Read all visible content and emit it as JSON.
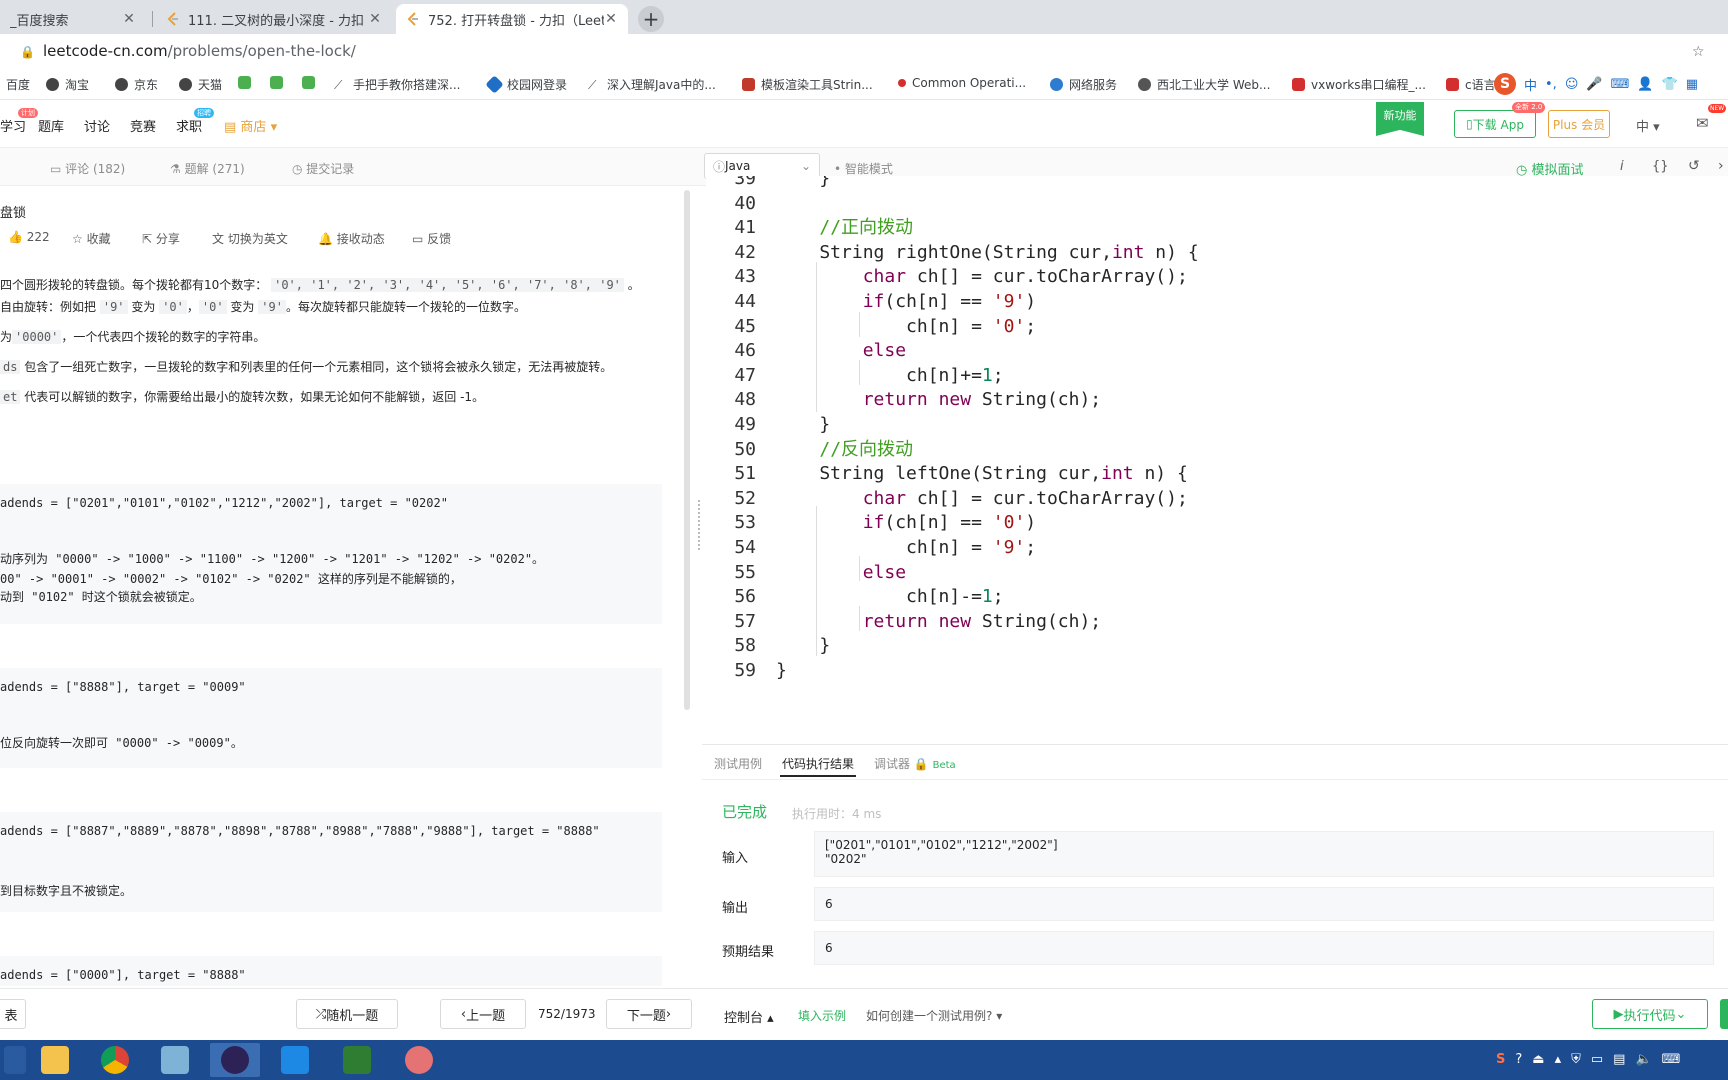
{
  "browser": {
    "tabs": [
      {
        "title": "_百度搜索",
        "active": false
      },
      {
        "title": "111. 二叉树的最小深度 - 力扣（L",
        "active": false
      },
      {
        "title": "752. 打开转盘锁 - 力扣（LeetCo",
        "active": true
      }
    ],
    "url_host": "leetcode-cn.com",
    "url_path": "/problems/open-the-lock/"
  },
  "bookmarks": [
    "百度",
    "淘宝",
    "京东",
    "天猫",
    "手把手教你搭建深...",
    "校园网登录",
    "深入理解Java中的...",
    "模板渲染工具Strin...",
    "Common Operati...",
    "网络服务",
    "西北工业大学 Web...",
    "vxworks串口编程_...",
    "c语言"
  ],
  "sitenav": {
    "items": [
      "学习",
      "题库",
      "讨论",
      "竞赛",
      "求职",
      "商店"
    ],
    "badge_plan": "计划",
    "badge_recruit": "招聘",
    "new_feature": "新功能",
    "download_app": "下载 App",
    "download_badge": "全新 2.0",
    "plus": "Plus 会员",
    "lang": "中",
    "notify_badge": "NEW"
  },
  "lefttools": {
    "comments": "评论 (182)",
    "solutions": "题解 (271)",
    "submissions": "提交记录"
  },
  "problem": {
    "title": "盘锁",
    "likes": "222",
    "favorite": "收藏",
    "share": "分享",
    "switch_lang": "切换为英文",
    "follow": "接收动态",
    "feedback": "反馈",
    "desc1": "四个圆形拨轮的转盘锁。每个拨轮都有10个数字：",
    "digits": "'0', '1', '2', '3', '4', '5', '6', '7', '8', '9'",
    "desc2a": "自由旋转：例如把",
    "desc2_c9": "'9'",
    "desc2b": "变为",
    "desc2_c0": "'0'",
    "desc2c": "，",
    "desc2_c0b": "'0'",
    "desc2d": "变为",
    "desc2_c9b": "'9'",
    "desc2e": "。每次旋转都只能旋转一个拨轮的一位数字。",
    "desc3a": "为",
    "desc3_code": "'0000'",
    "desc3b": "，一个代表四个拨轮的数字的字符串。",
    "desc4_code": "ds",
    "desc4": "包含了一组死亡数字，一旦拨轮的数字和列表里的任何一个元素相同，这个锁将会被永久锁定，无法再被旋转。",
    "desc5_code": "et",
    "desc5": "代表可以解锁的数字，你需要给出最小的旋转次数，如果无论如何不能解锁，返回 -1。",
    "ex1_input": "adends = [\"0201\",\"0101\",\"0102\",\"1212\",\"2002\"], target = \"0202\"",
    "ex1_l1": "动序列为 \"0000\" -> \"1000\" -> \"1100\" -> \"1200\" -> \"1201\" -> \"1202\" -> \"0202\"。",
    "ex1_l2": "00\" -> \"0001\" -> \"0002\" -> \"0102\" -> \"0202\" 这样的序列是不能解锁的，",
    "ex1_l3": "动到 \"0102\" 时这个锁就会被锁定。",
    "ex2_input": "adends = [\"8888\"], target = \"0009\"",
    "ex2_l1": "位反向旋转一次即可 \"0000\" -> \"0009\"。",
    "ex3_input": "adends = [\"8887\",\"8889\",\"8878\",\"8898\",\"8788\",\"8988\",\"7888\",\"9888\"], target = \"8888\"",
    "ex3_l1": "到目标数字且不被锁定。",
    "ex4_input": "adends = [\"0000\"], target = \"8888\""
  },
  "editorbar": {
    "language": "Java",
    "smart_mode": "智能模式",
    "mock_interview": "模拟面试"
  },
  "code": [
    {
      "n": "39",
      "text": "    }"
    },
    {
      "n": "40",
      "text": ""
    },
    {
      "n": "41",
      "text": "    //正向拨动"
    },
    {
      "n": "42",
      "text": "    String rightOne(String cur,int n) {"
    },
    {
      "n": "43",
      "text": "        char ch[] = cur.toCharArray();"
    },
    {
      "n": "44",
      "text": "        if(ch[n] == '9')"
    },
    {
      "n": "45",
      "text": "            ch[n] = '0';"
    },
    {
      "n": "46",
      "text": "        else"
    },
    {
      "n": "47",
      "text": "            ch[n]+=1;"
    },
    {
      "n": "48",
      "text": "        return new String(ch);"
    },
    {
      "n": "49",
      "text": "    }"
    },
    {
      "n": "50",
      "text": "    //反向拨动"
    },
    {
      "n": "51",
      "text": "    String leftOne(String cur,int n) {"
    },
    {
      "n": "52",
      "text": "        char ch[] = cur.toCharArray();"
    },
    {
      "n": "53",
      "text": "        if(ch[n] == '0')"
    },
    {
      "n": "54",
      "text": "            ch[n] = '9';"
    },
    {
      "n": "55",
      "text": "        else"
    },
    {
      "n": "56",
      "text": "            ch[n]-=1;"
    },
    {
      "n": "57",
      "text": "        return new String(ch);"
    },
    {
      "n": "58",
      "text": "    }"
    },
    {
      "n": "59",
      "text": "}"
    }
  ],
  "result": {
    "tab_testcase": "测试用例",
    "tab_result": "代码执行结果",
    "tab_debugger": "调试器",
    "beta": "Beta",
    "status": "已完成",
    "runtime": "执行用时：4 ms",
    "input_label": "输入",
    "input_line1": "[\"0201\",\"0101\",\"0102\",\"1212\",\"2002\"]",
    "input_line2": "\"0202\"",
    "output_label": "输出",
    "output_value": "6",
    "expected_label": "预期结果",
    "expected_value": "6"
  },
  "bottombar": {
    "list": "表",
    "random": "随机一题",
    "prev": "上一题",
    "counter": "752/1973",
    "next": "下一题",
    "console": "控制台",
    "fill_example": "填入示例",
    "howto": "如何创建一个测试用例?",
    "run": "执行代码"
  },
  "colors": {
    "accent_green": "#2db55d",
    "tab_bg": "#dee1e6",
    "taskbar": "#1d4b8f"
  }
}
